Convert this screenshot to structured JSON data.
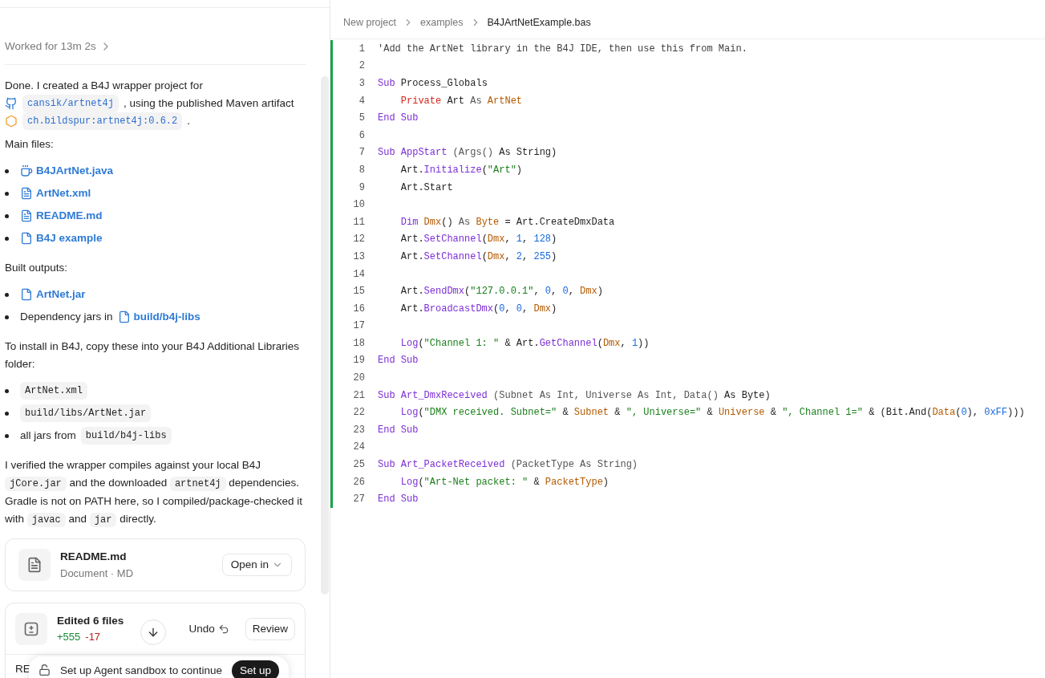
{
  "chat": {
    "worked": "Worked for 13m 2s",
    "blocks": [
      {
        "kind": "paragraph",
        "lines": [
          [
            {
              "kind": "text",
              "text": "Done. I created a B4J wrapper project for"
            }
          ],
          [
            {
              "kind": "repo",
              "text": "cansik/artnet4j"
            },
            {
              "kind": "text",
              "text": ", using the published Maven artifact"
            }
          ],
          [
            {
              "kind": "artifact",
              "text": "ch.bildspur:artnet4j:0.6.2"
            },
            {
              "kind": "text",
              "text": "."
            }
          ]
        ]
      },
      {
        "kind": "heading",
        "text": "Main files:"
      },
      {
        "kind": "list",
        "items": [
          [
            {
              "kind": "source",
              "text": "B4JArtNet.java"
            }
          ],
          [
            {
              "kind": "document",
              "text": "ArtNet.xml"
            }
          ],
          [
            {
              "kind": "document",
              "text": "README.md"
            }
          ],
          [
            {
              "kind": "file",
              "text": "B4J example"
            }
          ]
        ]
      },
      {
        "kind": "heading",
        "text": "Built outputs:"
      },
      {
        "kind": "list",
        "items": [
          [
            {
              "kind": "file",
              "text": "ArtNet.jar"
            }
          ],
          [
            {
              "kind": "text",
              "text": "Dependency jars in"
            },
            {
              "kind": "file",
              "text": "build/b4j-libs"
            }
          ]
        ]
      },
      {
        "kind": "heading",
        "text": "To install in B4J, copy these into your B4J Additional Libraries folder:"
      },
      {
        "kind": "list",
        "items": [
          [
            {
              "kind": "code",
              "text": "ArtNet.xml"
            }
          ],
          [
            {
              "kind": "code",
              "text": "build/libs/ArtNet.jar"
            }
          ],
          [
            {
              "kind": "text",
              "text": "all jars from"
            },
            {
              "kind": "code",
              "text": "build/b4j-libs"
            }
          ]
        ]
      },
      {
        "kind": "prose",
        "segments": [
          {
            "kind": "text",
            "text": "I verified the wrapper compiles against your local B4J "
          },
          {
            "kind": "code",
            "text": "jCore.jar"
          },
          {
            "kind": "text",
            "text": " and the downloaded "
          },
          {
            "kind": "code",
            "text": "artnet4j"
          },
          {
            "kind": "text",
            "text": " dependencies. Gradle is not on PATH here, so I compiled/package-checked it with "
          },
          {
            "kind": "code",
            "text": "javac"
          },
          {
            "kind": "text",
            "text": " and "
          },
          {
            "kind": "code",
            "text": "jar"
          },
          {
            "kind": "text",
            "text": " directly."
          }
        ]
      }
    ],
    "file_card": {
      "name": "README.md",
      "meta": "Document · MD",
      "button": "Open in"
    },
    "edits_card": {
      "title": "Edited 6 files",
      "added": "+555",
      "removed": "-17",
      "undo": "Undo",
      "review": "Review",
      "row_text": "RE"
    },
    "toast": {
      "text": "Set up Agent sandbox to continue",
      "button": "Set up"
    }
  },
  "editor": {
    "breadcrumb": [
      "New project",
      "examples",
      "B4JArtNetExample.bas"
    ],
    "lines": [
      {
        "number": "1",
        "indented": false,
        "tokens": [
          {
            "kind": "comment",
            "text": "'Add the ArtNet library in the B4J IDE, then use this from Main."
          }
        ]
      },
      {
        "number": "2"
      },
      {
        "number": "3",
        "indented": false,
        "tokens": [
          {
            "kind": "keyword",
            "text": "Sub "
          },
          {
            "kind": "plain",
            "text": "Process_Globals"
          }
        ]
      },
      {
        "number": "4",
        "indented": true,
        "tokens": [
          {
            "kind": "modifier",
            "text": "Private "
          },
          {
            "kind": "plain",
            "text": "Art "
          },
          {
            "kind": "dim",
            "text": "As "
          },
          {
            "kind": "type",
            "text": "ArtNet"
          }
        ]
      },
      {
        "number": "5",
        "indented": false,
        "tokens": [
          {
            "kind": "keyword",
            "text": "End Sub"
          }
        ]
      },
      {
        "number": "6"
      },
      {
        "number": "7",
        "indented": false,
        "tokens": [
          {
            "kind": "keyword",
            "text": "Sub AppStart"
          },
          {
            "kind": "dim",
            "text": " (Args() "
          },
          {
            "kind": "plain",
            "text": "As String)"
          }
        ]
      },
      {
        "number": "8",
        "indented": true,
        "tokens": [
          {
            "kind": "plain",
            "text": "Art."
          },
          {
            "kind": "keyword",
            "text": "Initialize"
          },
          {
            "kind": "plain",
            "text": "("
          },
          {
            "kind": "string",
            "text": "\"Art\""
          },
          {
            "kind": "plain",
            "text": ")"
          }
        ]
      },
      {
        "number": "9",
        "indented": true,
        "tokens": [
          {
            "kind": "plain",
            "text": "Art.Start"
          }
        ]
      },
      {
        "number": "10"
      },
      {
        "number": "11",
        "indented": true,
        "tokens": [
          {
            "kind": "keyword",
            "text": "Dim "
          },
          {
            "kind": "type",
            "text": "Dmx"
          },
          {
            "kind": "plain",
            "text": "() "
          },
          {
            "kind": "dim",
            "text": "As "
          },
          {
            "kind": "type",
            "text": "Byte"
          },
          {
            "kind": "plain",
            "text": " = Art.CreateDmxData"
          }
        ]
      },
      {
        "number": "12",
        "indented": true,
        "tokens": [
          {
            "kind": "plain",
            "text": "Art."
          },
          {
            "kind": "keyword",
            "text": "SetChannel"
          },
          {
            "kind": "plain",
            "text": "("
          },
          {
            "kind": "type",
            "text": "Dmx"
          },
          {
            "kind": "plain",
            "text": ", "
          },
          {
            "kind": "number",
            "text": "1"
          },
          {
            "kind": "plain",
            "text": ", "
          },
          {
            "kind": "number",
            "text": "128"
          },
          {
            "kind": "plain",
            "text": ")"
          }
        ]
      },
      {
        "number": "13",
        "indented": true,
        "tokens": [
          {
            "kind": "plain",
            "text": "Art."
          },
          {
            "kind": "keyword",
            "text": "SetChannel"
          },
          {
            "kind": "plain",
            "text": "("
          },
          {
            "kind": "type",
            "text": "Dmx"
          },
          {
            "kind": "plain",
            "text": ", "
          },
          {
            "kind": "number",
            "text": "2"
          },
          {
            "kind": "plain",
            "text": ", "
          },
          {
            "kind": "number",
            "text": "255"
          },
          {
            "kind": "plain",
            "text": ")"
          }
        ]
      },
      {
        "number": "14"
      },
      {
        "number": "15",
        "indented": true,
        "tokens": [
          {
            "kind": "plain",
            "text": "Art."
          },
          {
            "kind": "keyword",
            "text": "SendDmx"
          },
          {
            "kind": "plain",
            "text": "("
          },
          {
            "kind": "string",
            "text": "\"127.0.0.1\""
          },
          {
            "kind": "plain",
            "text": ", "
          },
          {
            "kind": "number",
            "text": "0"
          },
          {
            "kind": "plain",
            "text": ", "
          },
          {
            "kind": "number",
            "text": "0"
          },
          {
            "kind": "plain",
            "text": ", "
          },
          {
            "kind": "type",
            "text": "Dmx"
          },
          {
            "kind": "plain",
            "text": ")"
          }
        ]
      },
      {
        "number": "16",
        "indented": true,
        "tokens": [
          {
            "kind": "plain",
            "text": "Art."
          },
          {
            "kind": "keyword",
            "text": "BroadcastDmx"
          },
          {
            "kind": "plain",
            "text": "("
          },
          {
            "kind": "number",
            "text": "0"
          },
          {
            "kind": "plain",
            "text": ", "
          },
          {
            "kind": "number",
            "text": "0"
          },
          {
            "kind": "plain",
            "text": ", "
          },
          {
            "kind": "type",
            "text": "Dmx"
          },
          {
            "kind": "plain",
            "text": ")"
          }
        ]
      },
      {
        "number": "17"
      },
      {
        "number": "18",
        "indented": true,
        "tokens": [
          {
            "kind": "keyword",
            "text": "Log"
          },
          {
            "kind": "plain",
            "text": "("
          },
          {
            "kind": "string",
            "text": "\"Channel 1: \""
          },
          {
            "kind": "plain",
            "text": " & Art."
          },
          {
            "kind": "keyword",
            "text": "GetChannel"
          },
          {
            "kind": "plain",
            "text": "("
          },
          {
            "kind": "type",
            "text": "Dmx"
          },
          {
            "kind": "plain",
            "text": ", "
          },
          {
            "kind": "number",
            "text": "1"
          },
          {
            "kind": "plain",
            "text": "))"
          }
        ]
      },
      {
        "number": "19",
        "indented": false,
        "tokens": [
          {
            "kind": "keyword",
            "text": "End Sub"
          }
        ]
      },
      {
        "number": "20"
      },
      {
        "number": "21",
        "indented": false,
        "tokens": [
          {
            "kind": "keyword",
            "text": "Sub Art_DmxReceived"
          },
          {
            "kind": "dim",
            "text": " (Subnet As Int, Universe As Int, Data() "
          },
          {
            "kind": "plain",
            "text": "As Byte)"
          }
        ]
      },
      {
        "number": "22",
        "indented": true,
        "tokens": [
          {
            "kind": "keyword",
            "text": "Log"
          },
          {
            "kind": "plain",
            "text": "("
          },
          {
            "kind": "string",
            "text": "\"DMX received. Subnet=\""
          },
          {
            "kind": "plain",
            "text": " & "
          },
          {
            "kind": "type",
            "text": "Subnet"
          },
          {
            "kind": "plain",
            "text": " & "
          },
          {
            "kind": "string",
            "text": "\", Universe=\""
          },
          {
            "kind": "plain",
            "text": " & "
          },
          {
            "kind": "type",
            "text": "Universe"
          },
          {
            "kind": "plain",
            "text": " & "
          },
          {
            "kind": "string",
            "text": "\", Channel 1=\""
          },
          {
            "kind": "plain",
            "text": " & (Bit.And("
          },
          {
            "kind": "type",
            "text": "Data"
          },
          {
            "kind": "plain",
            "text": "("
          },
          {
            "kind": "number",
            "text": "0"
          },
          {
            "kind": "plain",
            "text": "), "
          },
          {
            "kind": "number",
            "text": "0xFF"
          },
          {
            "kind": "plain",
            "text": ")))"
          }
        ]
      },
      {
        "number": "23",
        "indented": false,
        "tokens": [
          {
            "kind": "keyword",
            "text": "End Sub"
          }
        ]
      },
      {
        "number": "24"
      },
      {
        "number": "25",
        "indented": false,
        "tokens": [
          {
            "kind": "keyword",
            "text": "Sub Art_PacketReceived"
          },
          {
            "kind": "dim",
            "text": " (PacketType As String)"
          }
        ]
      },
      {
        "number": "26",
        "indented": true,
        "tokens": [
          {
            "kind": "keyword",
            "text": "Log"
          },
          {
            "kind": "plain",
            "text": "("
          },
          {
            "kind": "string",
            "text": "\"Art-Net packet: \""
          },
          {
            "kind": "plain",
            "text": " & "
          },
          {
            "kind": "type",
            "text": "PacketType"
          },
          {
            "kind": "plain",
            "text": ")"
          }
        ]
      },
      {
        "number": "27",
        "indented": false,
        "tokens": [
          {
            "kind": "keyword",
            "text": "End Sub"
          }
        ]
      }
    ]
  }
}
